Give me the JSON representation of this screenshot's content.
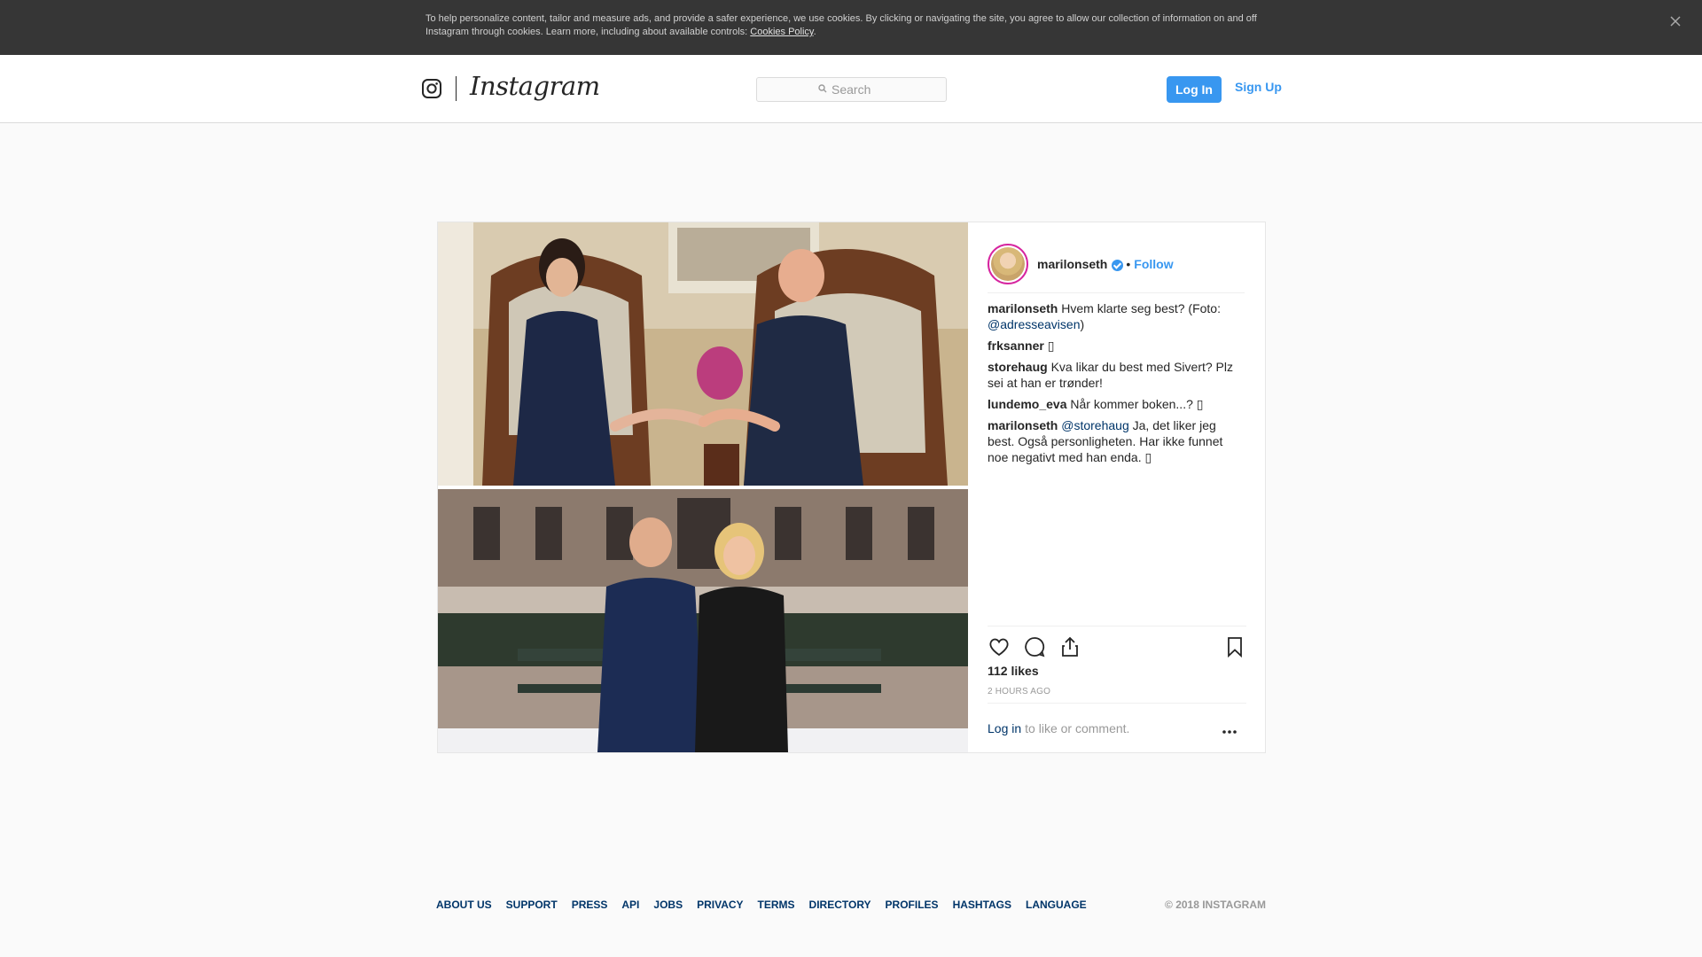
{
  "cookie_banner": {
    "text": "To help personalize content, tailor and measure ads, and provide a safer experience, we use cookies. By clicking or navigating the site, you agree to allow our collection of information on and off Instagram through cookies. Learn more, including about available controls: ",
    "link": "Cookies Policy",
    "suffix": ".",
    "close_icon": "close-icon"
  },
  "header": {
    "brand": "Instagram",
    "search_placeholder": "Search",
    "login_label": "Log In",
    "signup_label": "Sign Up"
  },
  "post": {
    "username": "marilonseth",
    "separator": "•",
    "follow_label": "Follow",
    "comments": [
      {
        "user": "marilonseth",
        "text": "Hvem klarte seg best? (Foto: ",
        "mention": "@adresseavisen",
        "after": ")"
      },
      {
        "user": "frksanner",
        "text": "▯"
      },
      {
        "user": "storehaug",
        "text": "Kva likar du best med Sivert? Plz sei at han er trønder!"
      },
      {
        "user": "lundemo_eva",
        "text": "Når kommer boken...? ▯"
      },
      {
        "user": "marilonseth",
        "mention": "@storehaug",
        "text": " Ja, det liker jeg best. Også personligheten. Har ikke funnet noe negativt med han enda. ▯"
      }
    ],
    "likes": "112 likes",
    "time": "2 HOURS AGO",
    "login_link": "Log in",
    "login_suffix": "to like or comment."
  },
  "footer": {
    "links": [
      "ABOUT US",
      "SUPPORT",
      "PRESS",
      "API",
      "JOBS",
      "PRIVACY",
      "TERMS",
      "DIRECTORY",
      "PROFILES",
      "HASHTAGS",
      "LANGUAGE"
    ],
    "copyright": "© 2018 INSTAGRAM"
  },
  "colors": {
    "accent": "#3897f0",
    "link_dark": "#003569",
    "banner_bg": "#363636"
  }
}
